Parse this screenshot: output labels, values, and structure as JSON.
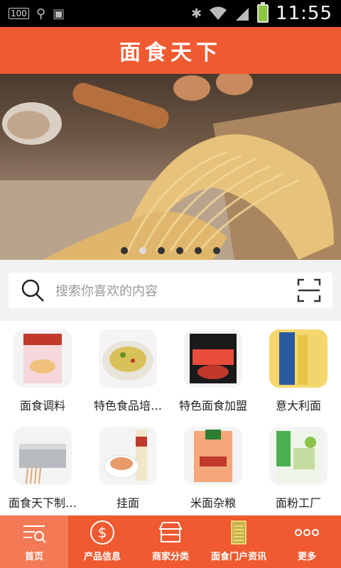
{
  "status_bar": {
    "battery_level": "100",
    "time": "11:55"
  },
  "header": {
    "title": "面食天下"
  },
  "banner": {
    "slide_count": 6,
    "active_index": 1
  },
  "search": {
    "placeholder": "搜索你喜欢的内容"
  },
  "categories": [
    {
      "label": "面食调料"
    },
    {
      "label": "特色食品培…"
    },
    {
      "label": "特色面食加盟"
    },
    {
      "label": "意大利面"
    },
    {
      "label": "面食天下制…"
    },
    {
      "label": "挂面"
    },
    {
      "label": "米面杂粮"
    },
    {
      "label": "面粉工厂"
    }
  ],
  "tabs": [
    {
      "label": "首页",
      "icon": "home-search-icon"
    },
    {
      "label": "产品信息",
      "icon": "dollar-icon"
    },
    {
      "label": "商家分类",
      "icon": "shop-icon"
    },
    {
      "label": "面食门户资讯",
      "icon": "document-icon"
    },
    {
      "label": "更多",
      "icon": "more-icon"
    }
  ],
  "colors": {
    "brand": "#f05a30",
    "active_tab": "#f47a55"
  }
}
